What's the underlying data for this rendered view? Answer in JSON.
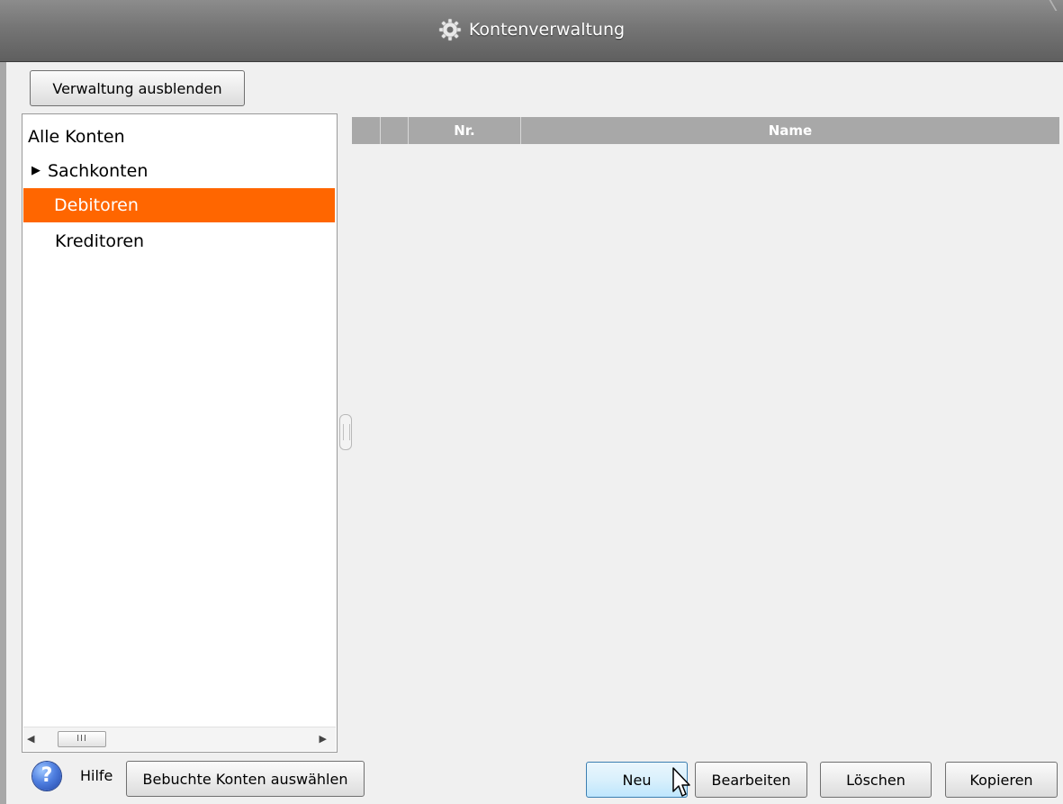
{
  "window": {
    "title": "Kontenverwaltung",
    "title_icon": "gear-icon"
  },
  "toolbar": {
    "toggle_admin_label": "Verwaltung ausblenden"
  },
  "tree": {
    "root": "Alle Konten",
    "items": [
      {
        "label": "Sachkonten",
        "expander": "▶",
        "selected": false
      },
      {
        "label": "Debitoren",
        "selected": true
      },
      {
        "label": "Kreditoren",
        "selected": false
      }
    ],
    "selected_color": "#ff6600"
  },
  "table": {
    "columns": [
      "",
      "",
      "Nr.",
      "Name"
    ],
    "rows": []
  },
  "footer": {
    "help_icon_glyph": "?",
    "help_label": "Hilfe",
    "booked_label": "Bebuchte Konten auswählen",
    "new_label": "Neu",
    "edit_label": "Bearbeiten",
    "delete_label": "Löschen",
    "copy_label": "Kopieren"
  },
  "scrollbar": {
    "left_arrow": "◀",
    "thumb_grip": "III",
    "right_arrow": "▶"
  }
}
